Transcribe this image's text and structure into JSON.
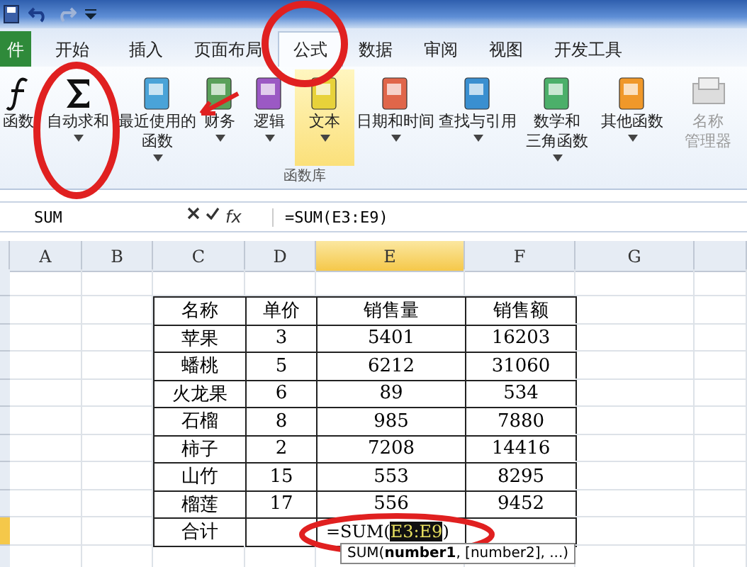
{
  "tabs": [
    {
      "label": "件",
      "kind": "file",
      "selected": false
    },
    {
      "label": "开始",
      "kind": "tab",
      "selected": false
    },
    {
      "label": "插入",
      "kind": "tab",
      "selected": false
    },
    {
      "label": "页面布局",
      "kind": "tab",
      "selected": false
    },
    {
      "label": "公式",
      "kind": "tab",
      "selected": true
    },
    {
      "label": "数据",
      "kind": "tab",
      "selected": false
    },
    {
      "label": "审阅",
      "kind": "tab",
      "selected": false
    },
    {
      "label": "视图",
      "kind": "tab",
      "selected": false
    },
    {
      "label": "开发工具",
      "kind": "tab",
      "selected": false
    }
  ],
  "ribbon": {
    "group_label": "函数库",
    "items": [
      {
        "kind": "fx",
        "lines": [
          "函数"
        ],
        "dropdown": false,
        "selected": false,
        "disabled": false
      },
      {
        "kind": "sigma",
        "lines": [
          "自动求和"
        ],
        "dropdown": true,
        "selected": false,
        "disabled": false
      },
      {
        "kind": "book",
        "color": "#4aa3d8",
        "lines": [
          "最近使用的",
          "函数"
        ],
        "dropdown": true,
        "selected": false,
        "disabled": false
      },
      {
        "kind": "book",
        "color": "#5aa05a",
        "lines": [
          "财务"
        ],
        "dropdown": true,
        "selected": false,
        "disabled": false
      },
      {
        "kind": "book",
        "color": "#9b59c4",
        "lines": [
          "逻辑"
        ],
        "dropdown": true,
        "selected": false,
        "disabled": false
      },
      {
        "kind": "book",
        "color": "#e8d23a",
        "lines": [
          "文本"
        ],
        "dropdown": true,
        "selected": true,
        "disabled": false
      },
      {
        "kind": "book",
        "color": "#e0664a",
        "lines": [
          "日期和时间"
        ],
        "dropdown": true,
        "selected": false,
        "disabled": false
      },
      {
        "kind": "book",
        "color": "#3a8fd0",
        "lines": [
          "查找与引用"
        ],
        "dropdown": true,
        "selected": false,
        "disabled": false
      },
      {
        "kind": "book",
        "color": "#4caf6a",
        "lines": [
          "数学和",
          "三角函数"
        ],
        "dropdown": true,
        "selected": false,
        "disabled": false
      },
      {
        "kind": "book",
        "color": "#f0982a",
        "lines": [
          "其他函数"
        ],
        "dropdown": true,
        "selected": false,
        "disabled": false
      },
      {
        "kind": "names",
        "lines": [
          "名称",
          "管理器"
        ],
        "dropdown": false,
        "selected": false,
        "disabled": true
      }
    ]
  },
  "formula_bar": {
    "name_box": "SUM",
    "formula": "=SUM(E3:E9)"
  },
  "sheet": {
    "columns": [
      {
        "label": "A",
        "selected": false
      },
      {
        "label": "B",
        "selected": false
      },
      {
        "label": "C",
        "selected": false
      },
      {
        "label": "D",
        "selected": false
      },
      {
        "label": "E",
        "selected": true
      },
      {
        "label": "F",
        "selected": false
      },
      {
        "label": "G",
        "selected": false
      }
    ],
    "table": {
      "header": [
        "名称",
        "单价",
        "销售量",
        "销售额"
      ],
      "rows": [
        [
          "苹果",
          "3",
          "5401",
          "16203"
        ],
        [
          "蟠桃",
          "5",
          "6212",
          "31060"
        ],
        [
          "火龙果",
          "6",
          "89",
          "534"
        ],
        [
          "石榴",
          "8",
          "985",
          "7880"
        ],
        [
          "柿子",
          "2",
          "7208",
          "14416"
        ],
        [
          "山竹",
          "15",
          "553",
          "8295"
        ],
        [
          "榴莲",
          "17",
          "556",
          "9452"
        ]
      ],
      "total": {
        "label": "合计",
        "formula_parts": [
          "=SUM(",
          "E3:E9",
          ")"
        ]
      }
    },
    "tooltip": "SUM(**number1**, [number2], ...)"
  }
}
